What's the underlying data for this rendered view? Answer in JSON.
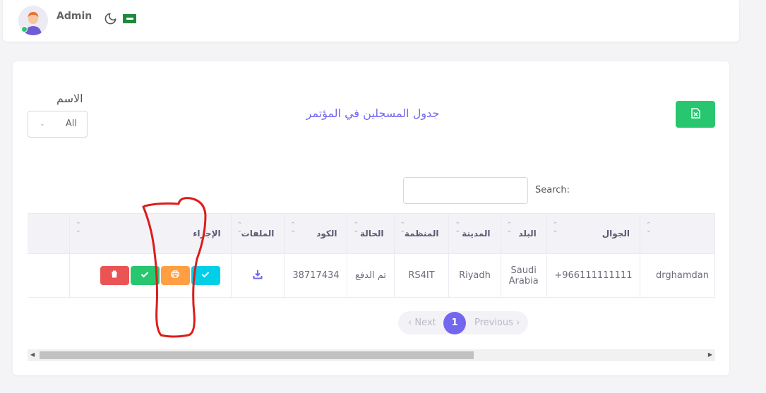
{
  "header": {
    "user_name": "Admin",
    "theme_icon": "moon-icon",
    "language_flag": "saudi-flag-icon"
  },
  "card": {
    "title": "جدول المسجلين في المؤتمر",
    "filter_label": "الاسم",
    "filter_value": "All",
    "export_icon": "excel-file-icon",
    "search_label": "Search:",
    "search_value": ""
  },
  "table": {
    "columns": [
      "",
      "الجوال",
      "البلد",
      "المدينة",
      "المنظمة",
      "الحالة",
      "الكود",
      "الملفات",
      "الإجراء"
    ],
    "rows": [
      {
        "email": "drghamdan",
        "mobile": "+966111111111",
        "country": "Saudi Arabia",
        "city": "Riyadh",
        "organization": "RS4IT",
        "status": "تم الدفع",
        "code": "38717434",
        "files_icon": "download-icon",
        "actions": [
          "confirm-icon",
          "print-icon",
          "check-icon",
          "delete-icon"
        ]
      }
    ]
  },
  "pagination": {
    "next_label": "Next",
    "current_page": "1",
    "prev_label": "Previous"
  },
  "colors": {
    "primary": "#7367f0",
    "success": "#28c76f",
    "danger": "#ea5455",
    "warning": "#ff9f43",
    "info": "#00cfe8",
    "annotation": "#dd1c1a"
  }
}
